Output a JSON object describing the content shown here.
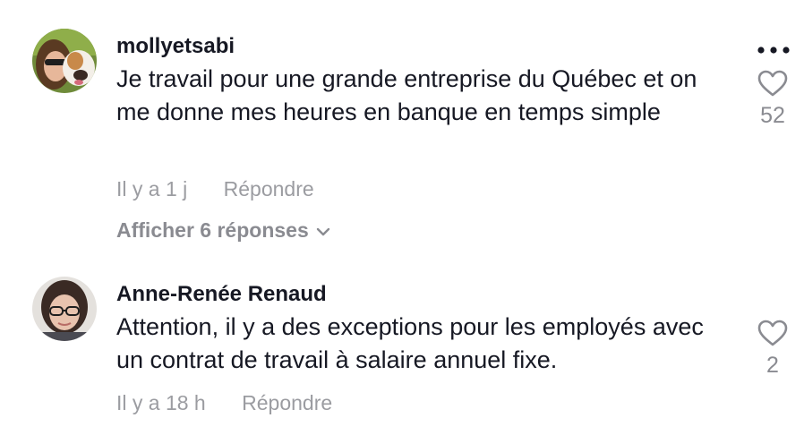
{
  "comments": [
    {
      "username": "mollyetsabi",
      "text": "Je travail pour une grande entreprise du Québec et on me donne mes heures en banque en temps simple",
      "time": "Il y a 1 j",
      "reply_label": "Répondre",
      "likes": "52",
      "replies_label": "Afficher 6 réponses"
    },
    {
      "username": "Anne-Renée Renaud",
      "text": "Attention, il y a des exceptions pour les employés avec un contrat de travail à salaire annuel fixe.",
      "time": "Il y a 18 h",
      "reply_label": "Répondre",
      "likes": "2"
    }
  ],
  "icons": {
    "more": "more-dots-icon",
    "like": "heart-outline-icon",
    "expand": "chevron-down-icon"
  },
  "colors": {
    "primary_text": "#161823",
    "secondary_text": "#9b9ca1",
    "background": "#ffffff"
  }
}
